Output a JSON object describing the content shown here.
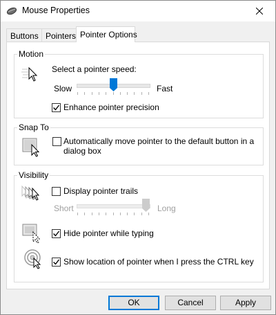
{
  "window": {
    "title": "Mouse Properties",
    "close_icon": "close-icon"
  },
  "tabs": [
    {
      "label": "Buttons",
      "active": false
    },
    {
      "label": "Pointers",
      "active": false
    },
    {
      "label": "Pointer Options",
      "active": true
    }
  ],
  "motion": {
    "heading": "Motion",
    "prompt": "Select a pointer speed:",
    "slow_label": "Slow",
    "fast_label": "Fast",
    "speed_level": 0.5,
    "enhance_precision": {
      "label": "Enhance pointer precision",
      "checked": true
    }
  },
  "snap_to": {
    "heading": "Snap To",
    "option": {
      "label_line1": "Automatically move pointer to the default button in a",
      "label_line2": "dialog box",
      "checked": false
    }
  },
  "visibility": {
    "heading": "Visibility",
    "trails": {
      "label": "Display pointer trails",
      "checked": false
    },
    "trail_length": {
      "short_label": "Short",
      "long_label": "Long",
      "level": 1.0,
      "enabled": false
    },
    "hide_typing": {
      "label": "Hide pointer while typing",
      "checked": true
    },
    "show_ctrl": {
      "label": "Show location of pointer when I press the CTRL key",
      "checked": true
    }
  },
  "buttons": {
    "ok": "OK",
    "cancel": "Cancel",
    "apply": "Apply"
  },
  "colors": {
    "accent": "#0078d7",
    "group_border": "#dcdcdc",
    "dialog_bg": "#f0f0f0"
  }
}
